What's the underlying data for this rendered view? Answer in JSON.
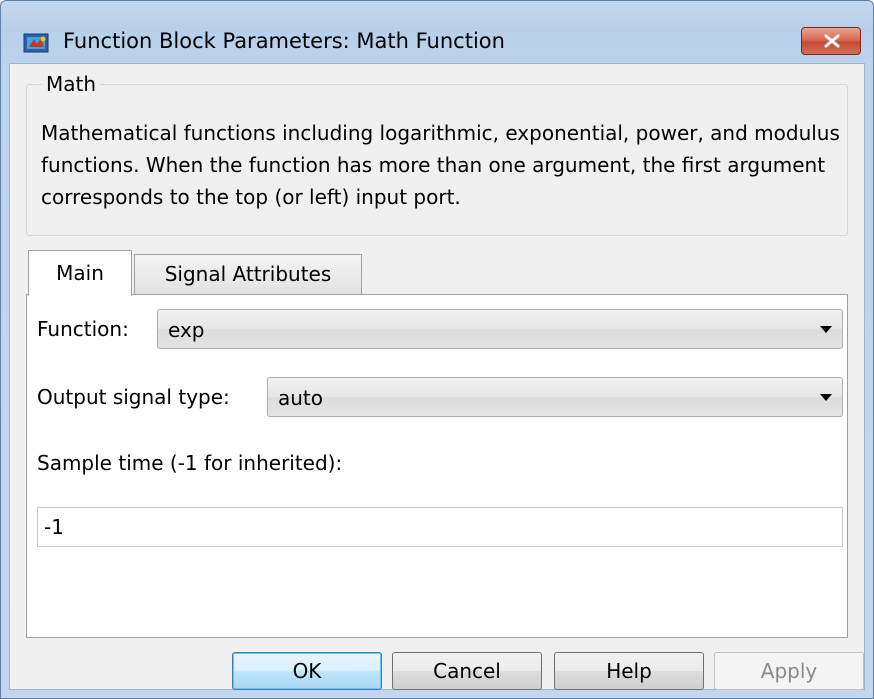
{
  "window": {
    "title": "Function Block Parameters: Math Function"
  },
  "group": {
    "title": "Math",
    "description": "Mathematical functions including logarithmic, exponential, power, and modulus functions.  When the function has more than one argument, the first argument corresponds to the top (or left) input port."
  },
  "tabs": [
    {
      "label": "Main",
      "selected": true
    },
    {
      "label": "Signal Attributes",
      "selected": false
    }
  ],
  "params": {
    "function_label": "Function:",
    "function_value": "exp",
    "output_type_label": "Output signal type:",
    "output_type_value": "auto",
    "sample_time_label": "Sample time (-1 for inherited):",
    "sample_time_value": "-1"
  },
  "buttons": {
    "ok": "OK",
    "cancel": "Cancel",
    "help": "Help",
    "apply": "Apply"
  },
  "icons": {
    "app": "simulink-block-icon",
    "close": "close-icon",
    "dropdown": "chevron-down-icon"
  },
  "colors": {
    "close_button": "#c74a33",
    "default_button_border": "#3c7fb1",
    "disabled_text": "#8a8a8a"
  }
}
